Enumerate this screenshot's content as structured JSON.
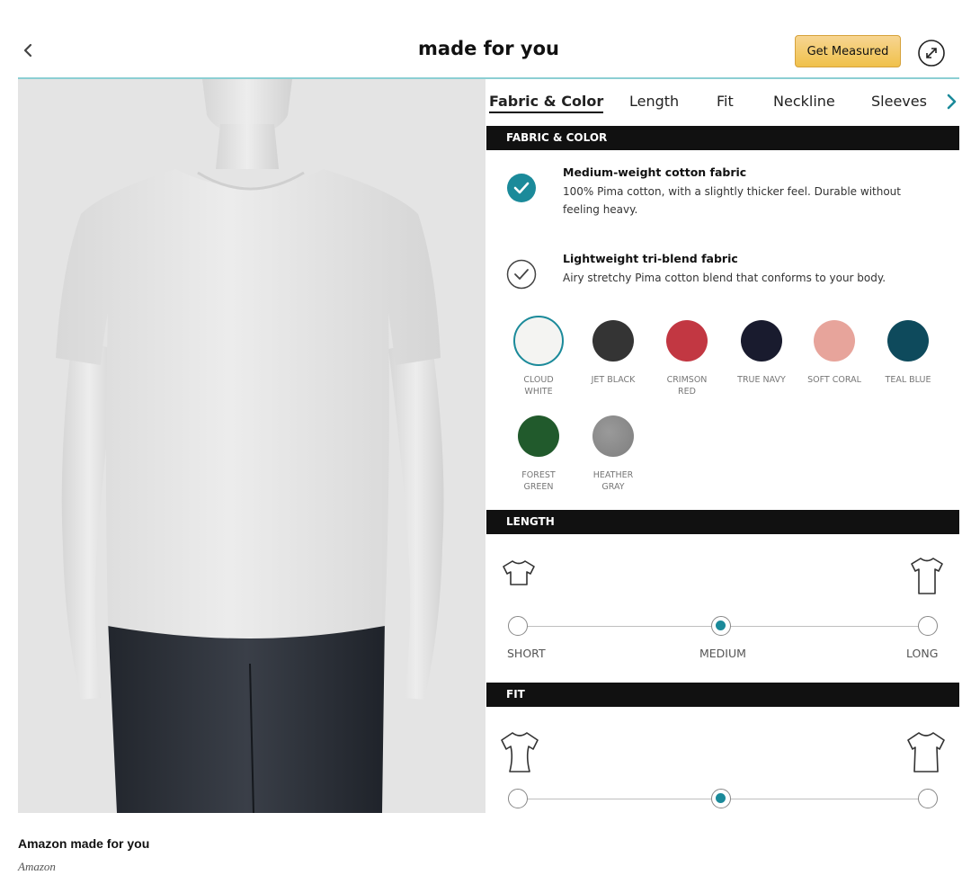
{
  "header": {
    "title": "made for you",
    "get_measured_label": "Get Measured"
  },
  "tabs": [
    {
      "label": "Fabric & Color",
      "active": true
    },
    {
      "label": "Length",
      "active": false
    },
    {
      "label": "Fit",
      "active": false
    },
    {
      "label": "Neckline",
      "active": false
    },
    {
      "label": "Sleeves",
      "active": false
    }
  ],
  "fabric_color": {
    "section_title": "FABRIC & COLOR",
    "options": [
      {
        "name": "Medium-weight cotton fabric",
        "description": "100% Pima cotton, with a slightly thicker feel. Durable without feeling heavy.",
        "selected": true
      },
      {
        "name": "Lightweight tri-blend fabric",
        "description": "Airy stretchy Pima cotton blend that conforms to your body.",
        "selected": false
      }
    ],
    "swatches": [
      {
        "label_line1": "CLOUD",
        "label_line2": "WHITE",
        "color": "#f4f4f2",
        "selected": true
      },
      {
        "label_line1": "JET BLACK",
        "label_line2": "",
        "color": "#343434",
        "selected": false
      },
      {
        "label_line1": "CRIMSON",
        "label_line2": "RED",
        "color": "#c23742",
        "selected": false
      },
      {
        "label_line1": "TRUE NAVY",
        "label_line2": "",
        "color": "#191b2e",
        "selected": false
      },
      {
        "label_line1": "SOFT CORAL",
        "label_line2": "",
        "color": "#e7a49b",
        "selected": false
      },
      {
        "label_line1": "TEAL BLUE",
        "label_line2": "",
        "color": "#0e4a5c",
        "selected": false
      },
      {
        "label_line1": "FOREST",
        "label_line2": "GREEN",
        "color": "#215a2c",
        "selected": false
      },
      {
        "label_line1": "HEATHER",
        "label_line2": "GRAY",
        "color": "#8a8a8a",
        "selected": false
      }
    ]
  },
  "length": {
    "section_title": "LENGTH",
    "stops": [
      "SHORT",
      "MEDIUM",
      "LONG"
    ],
    "selected": "MEDIUM"
  },
  "fit": {
    "section_title": "FIT",
    "selected_index": 1
  },
  "caption": {
    "title": "Amazon made for you",
    "credit": "Amazon"
  },
  "colors": {
    "accent_teal": "#1b8a9a",
    "button_gold": "#f0c14b",
    "section_bar": "#111111"
  }
}
